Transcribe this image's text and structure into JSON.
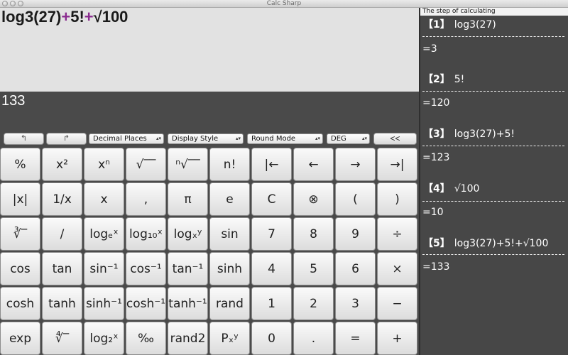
{
  "window": {
    "title": "Calc Sharp"
  },
  "expression": {
    "parts": [
      "log3(27)",
      "+",
      "5!",
      "+",
      "√100"
    ]
  },
  "result": "133",
  "toolbar": {
    "undo_label": "↰",
    "redo_label": "↱",
    "decimal_places": "Decimal Places",
    "display_style": "Display Style",
    "round_mode": "Round Mode",
    "angle_mode": "DEG",
    "backspace_label": "<<"
  },
  "keys": [
    [
      "%",
      "x²",
      "xⁿ",
      "√‾‾",
      "ⁿ√‾‾",
      "n!",
      "|←",
      "←",
      "→",
      "→|"
    ],
    [
      "|x|",
      "1/x",
      "x",
      ",",
      "π",
      "e",
      "C",
      "⊗",
      "(",
      ")"
    ],
    [
      "∛‾",
      "/",
      "logₑˣ",
      "log₁₀ˣ",
      "logₓʸ",
      "sin",
      "7",
      "8",
      "9",
      "÷"
    ],
    [
      "cos",
      "tan",
      "sin⁻¹",
      "cos⁻¹",
      "tan⁻¹",
      "sinh",
      "4",
      "5",
      "6",
      "×"
    ],
    [
      "cosh",
      "tanh",
      "sinh⁻¹",
      "cosh⁻¹",
      "tanh⁻¹",
      "rand",
      "1",
      "2",
      "3",
      "−"
    ],
    [
      "exp",
      "∜‾",
      "log₂ˣ",
      "‰",
      "rand2",
      "Pₓʸ",
      "0",
      ".",
      "=",
      "+"
    ]
  ],
  "steps_panel": {
    "header": "The step of calculating",
    "steps": [
      {
        "index": "【1】",
        "expr": "log3(27)",
        "result": "=3"
      },
      {
        "index": "【2】",
        "expr": "5!",
        "result": "=120"
      },
      {
        "index": "【3】",
        "expr": "log3(27)+5!",
        "result": "=123"
      },
      {
        "index": "【4】",
        "expr": "√100",
        "result": "=10"
      },
      {
        "index": "【5】",
        "expr": "log3(27)+5!+√100",
        "result": "=133"
      }
    ]
  }
}
